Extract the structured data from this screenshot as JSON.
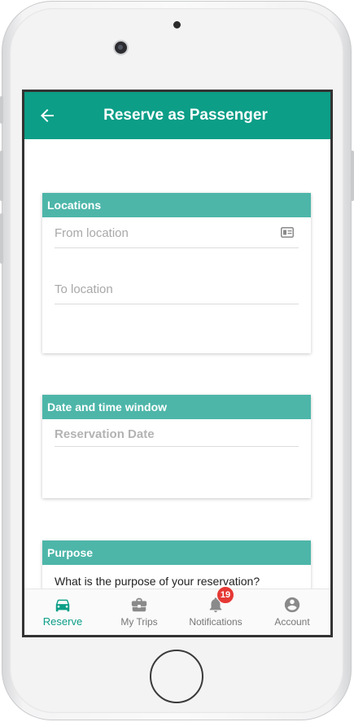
{
  "header": {
    "title": "Reserve as Passenger",
    "back_icon": "arrow-left-icon"
  },
  "sections": {
    "locations": {
      "title": "Locations",
      "from_placeholder": "From location",
      "to_placeholder": "To location",
      "from_icon": "contact-card-icon"
    },
    "datetime": {
      "title": "Date and time window",
      "date_placeholder": "Reservation Date"
    },
    "purpose": {
      "title": "Purpose",
      "question": "What is the purpose of your reservation?"
    }
  },
  "bottom_nav": {
    "items": [
      {
        "label": "Reserve",
        "icon": "car-icon",
        "active": true
      },
      {
        "label": "My Trips",
        "icon": "briefcase-icon",
        "active": false
      },
      {
        "label": "Notifications",
        "icon": "bell-icon",
        "active": false,
        "badge": "19"
      },
      {
        "label": "Account",
        "icon": "account-circle-icon",
        "active": false
      }
    ]
  },
  "colors": {
    "primary": "#0c9e87",
    "section_header": "#4db6a9",
    "badge": "#e53935",
    "inactive": "#777777"
  }
}
